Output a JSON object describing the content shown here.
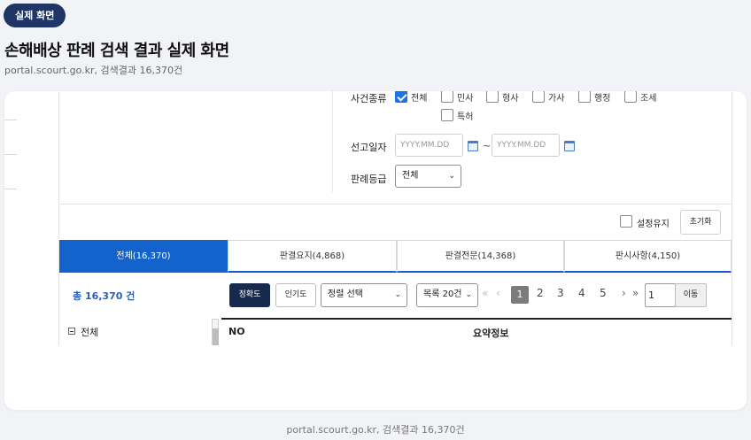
{
  "badge": "실제 화면",
  "title": "손해배상 판례 검색 결과 실제 화면",
  "subtitle": "portal.scourt.go.kr, 검색결과 16,370건",
  "filters": {
    "case_type_label": "사건종류",
    "case_types": [
      {
        "label": "전체",
        "checked": true
      },
      {
        "label": "민사",
        "checked": false
      },
      {
        "label": "형사",
        "checked": false
      },
      {
        "label": "가사",
        "checked": false
      },
      {
        "label": "행정",
        "checked": false
      },
      {
        "label": "조세",
        "checked": false
      },
      {
        "label": "특허",
        "checked": false
      }
    ],
    "date_label": "선고일자",
    "date_from_placeholder": "YYYY.MM.DD",
    "date_sep": "~",
    "date_to_placeholder": "YYYY.MM.DD",
    "grade_label": "판례등급",
    "grade_value": "전체"
  },
  "options": {
    "keep_settings_label": "설정유지",
    "keep_settings_checked": false,
    "reset_label": "초기화"
  },
  "tabs": [
    {
      "label": "전체(16,370)",
      "active": true
    },
    {
      "label": "판결요지(4,868)",
      "active": false
    },
    {
      "label": "판결전문(14,368)",
      "active": false
    },
    {
      "label": "판시사항(4,150)",
      "active": false
    }
  ],
  "results": {
    "total_label": "총 16,370 건",
    "sort_accuracy": "정확도",
    "sort_popularity": "인기도",
    "sort_select": "정렬 선택",
    "page_size_select": "목록 20건",
    "pages": [
      "1",
      "2",
      "3",
      "4",
      "5"
    ],
    "current_page": "1",
    "goto_value": "1",
    "goto_label": "이동"
  },
  "table": {
    "tree_root": "전체",
    "col_no": "NO",
    "col_summary": "요약정보"
  },
  "footer_caption": "portal.scourt.go.kr, 검색결과 16,370건",
  "colors": {
    "brand_navy": "#1f3566",
    "tab_active": "#1463cc",
    "checkbox_blue": "#1a73e8",
    "total_blue": "#2c5fb8"
  }
}
